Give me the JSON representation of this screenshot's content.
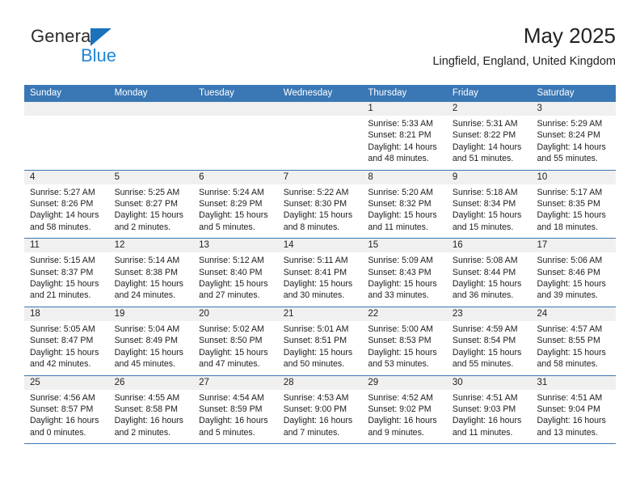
{
  "brand": {
    "word1": "General",
    "word2": "Blue",
    "triangle_icon": "triangle-icon",
    "color_dark": "#2b2b2b",
    "color_blue": "#2086d6",
    "color_triangle": "#1a72ba"
  },
  "header": {
    "title": "May 2025",
    "subtitle": "Lingfield, England, United Kingdom",
    "accent_color": "#3a77b5"
  },
  "calendar": {
    "weekday_headers": [
      "Sunday",
      "Monday",
      "Tuesday",
      "Wednesday",
      "Thursday",
      "Friday",
      "Saturday"
    ],
    "weeks": [
      [
        {
          "day": "",
          "lines": []
        },
        {
          "day": "",
          "lines": []
        },
        {
          "day": "",
          "lines": []
        },
        {
          "day": "",
          "lines": []
        },
        {
          "day": "1",
          "lines": [
            "Sunrise: 5:33 AM",
            "Sunset: 8:21 PM",
            "Daylight: 14 hours",
            "and 48 minutes."
          ]
        },
        {
          "day": "2",
          "lines": [
            "Sunrise: 5:31 AM",
            "Sunset: 8:22 PM",
            "Daylight: 14 hours",
            "and 51 minutes."
          ]
        },
        {
          "day": "3",
          "lines": [
            "Sunrise: 5:29 AM",
            "Sunset: 8:24 PM",
            "Daylight: 14 hours",
            "and 55 minutes."
          ]
        }
      ],
      [
        {
          "day": "4",
          "lines": [
            "Sunrise: 5:27 AM",
            "Sunset: 8:26 PM",
            "Daylight: 14 hours",
            "and 58 minutes."
          ]
        },
        {
          "day": "5",
          "lines": [
            "Sunrise: 5:25 AM",
            "Sunset: 8:27 PM",
            "Daylight: 15 hours",
            "and 2 minutes."
          ]
        },
        {
          "day": "6",
          "lines": [
            "Sunrise: 5:24 AM",
            "Sunset: 8:29 PM",
            "Daylight: 15 hours",
            "and 5 minutes."
          ]
        },
        {
          "day": "7",
          "lines": [
            "Sunrise: 5:22 AM",
            "Sunset: 8:30 PM",
            "Daylight: 15 hours",
            "and 8 minutes."
          ]
        },
        {
          "day": "8",
          "lines": [
            "Sunrise: 5:20 AM",
            "Sunset: 8:32 PM",
            "Daylight: 15 hours",
            "and 11 minutes."
          ]
        },
        {
          "day": "9",
          "lines": [
            "Sunrise: 5:18 AM",
            "Sunset: 8:34 PM",
            "Daylight: 15 hours",
            "and 15 minutes."
          ]
        },
        {
          "day": "10",
          "lines": [
            "Sunrise: 5:17 AM",
            "Sunset: 8:35 PM",
            "Daylight: 15 hours",
            "and 18 minutes."
          ]
        }
      ],
      [
        {
          "day": "11",
          "lines": [
            "Sunrise: 5:15 AM",
            "Sunset: 8:37 PM",
            "Daylight: 15 hours",
            "and 21 minutes."
          ]
        },
        {
          "day": "12",
          "lines": [
            "Sunrise: 5:14 AM",
            "Sunset: 8:38 PM",
            "Daylight: 15 hours",
            "and 24 minutes."
          ]
        },
        {
          "day": "13",
          "lines": [
            "Sunrise: 5:12 AM",
            "Sunset: 8:40 PM",
            "Daylight: 15 hours",
            "and 27 minutes."
          ]
        },
        {
          "day": "14",
          "lines": [
            "Sunrise: 5:11 AM",
            "Sunset: 8:41 PM",
            "Daylight: 15 hours",
            "and 30 minutes."
          ]
        },
        {
          "day": "15",
          "lines": [
            "Sunrise: 5:09 AM",
            "Sunset: 8:43 PM",
            "Daylight: 15 hours",
            "and 33 minutes."
          ]
        },
        {
          "day": "16",
          "lines": [
            "Sunrise: 5:08 AM",
            "Sunset: 8:44 PM",
            "Daylight: 15 hours",
            "and 36 minutes."
          ]
        },
        {
          "day": "17",
          "lines": [
            "Sunrise: 5:06 AM",
            "Sunset: 8:46 PM",
            "Daylight: 15 hours",
            "and 39 minutes."
          ]
        }
      ],
      [
        {
          "day": "18",
          "lines": [
            "Sunrise: 5:05 AM",
            "Sunset: 8:47 PM",
            "Daylight: 15 hours",
            "and 42 minutes."
          ]
        },
        {
          "day": "19",
          "lines": [
            "Sunrise: 5:04 AM",
            "Sunset: 8:49 PM",
            "Daylight: 15 hours",
            "and 45 minutes."
          ]
        },
        {
          "day": "20",
          "lines": [
            "Sunrise: 5:02 AM",
            "Sunset: 8:50 PM",
            "Daylight: 15 hours",
            "and 47 minutes."
          ]
        },
        {
          "day": "21",
          "lines": [
            "Sunrise: 5:01 AM",
            "Sunset: 8:51 PM",
            "Daylight: 15 hours",
            "and 50 minutes."
          ]
        },
        {
          "day": "22",
          "lines": [
            "Sunrise: 5:00 AM",
            "Sunset: 8:53 PM",
            "Daylight: 15 hours",
            "and 53 minutes."
          ]
        },
        {
          "day": "23",
          "lines": [
            "Sunrise: 4:59 AM",
            "Sunset: 8:54 PM",
            "Daylight: 15 hours",
            "and 55 minutes."
          ]
        },
        {
          "day": "24",
          "lines": [
            "Sunrise: 4:57 AM",
            "Sunset: 8:55 PM",
            "Daylight: 15 hours",
            "and 58 minutes."
          ]
        }
      ],
      [
        {
          "day": "25",
          "lines": [
            "Sunrise: 4:56 AM",
            "Sunset: 8:57 PM",
            "Daylight: 16 hours",
            "and 0 minutes."
          ]
        },
        {
          "day": "26",
          "lines": [
            "Sunrise: 4:55 AM",
            "Sunset: 8:58 PM",
            "Daylight: 16 hours",
            "and 2 minutes."
          ]
        },
        {
          "day": "27",
          "lines": [
            "Sunrise: 4:54 AM",
            "Sunset: 8:59 PM",
            "Daylight: 16 hours",
            "and 5 minutes."
          ]
        },
        {
          "day": "28",
          "lines": [
            "Sunrise: 4:53 AM",
            "Sunset: 9:00 PM",
            "Daylight: 16 hours",
            "and 7 minutes."
          ]
        },
        {
          "day": "29",
          "lines": [
            "Sunrise: 4:52 AM",
            "Sunset: 9:02 PM",
            "Daylight: 16 hours",
            "and 9 minutes."
          ]
        },
        {
          "day": "30",
          "lines": [
            "Sunrise: 4:51 AM",
            "Sunset: 9:03 PM",
            "Daylight: 16 hours",
            "and 11 minutes."
          ]
        },
        {
          "day": "31",
          "lines": [
            "Sunrise: 4:51 AM",
            "Sunset: 9:04 PM",
            "Daylight: 16 hours",
            "and 13 minutes."
          ]
        }
      ]
    ]
  }
}
